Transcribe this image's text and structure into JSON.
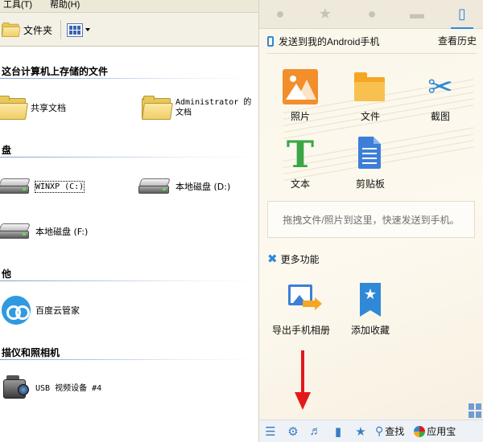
{
  "explorer": {
    "menu": [
      "工具(T)",
      "帮助(H)"
    ],
    "toolbar": {
      "folders_label": "文件夹"
    },
    "sections": {
      "stored": "这台计算机上存储的文件",
      "drives": "盘",
      "other": "他",
      "scanners": "描仪和照相机"
    },
    "items": {
      "shared_docs": "共享文档",
      "admin_docs": "Administrator 的文档",
      "drive_c": "WINXP (C:)",
      "drive_d": "本地磁盘 (D:)",
      "drive_f": "本地磁盘 (F:)",
      "baidu": "百度云管家",
      "usb_cam": "USB 视频设备 #4"
    }
  },
  "assistant": {
    "send_to": "发送到我的Android手机",
    "history": "查看历史",
    "tiles": {
      "photo": "照片",
      "file": "文件",
      "screenshot": "截图",
      "text": "文本",
      "clipboard": "剪贴板"
    },
    "drop_hint": "拖拽文件/照片到这里，快速发送到手机。",
    "more_features": "更多功能",
    "more_tiles": {
      "export_album": "导出手机相册",
      "add_favorite": "添加收藏"
    },
    "bottom": {
      "search": "查找",
      "app_store": "应用宝"
    }
  },
  "colors": {
    "accent": "#2f89d6",
    "arrow": "#e2191b",
    "photo": "#f28e2b",
    "folder": "#f5a623",
    "text_icon": "#3aa745"
  },
  "icons": [
    "contact-icon",
    "star-icon",
    "people-icon",
    "message-icon",
    "phone-icon",
    "menu-icon",
    "gear-icon",
    "volume-icon",
    "folder-icon",
    "star-add-icon",
    "search-icon"
  ]
}
